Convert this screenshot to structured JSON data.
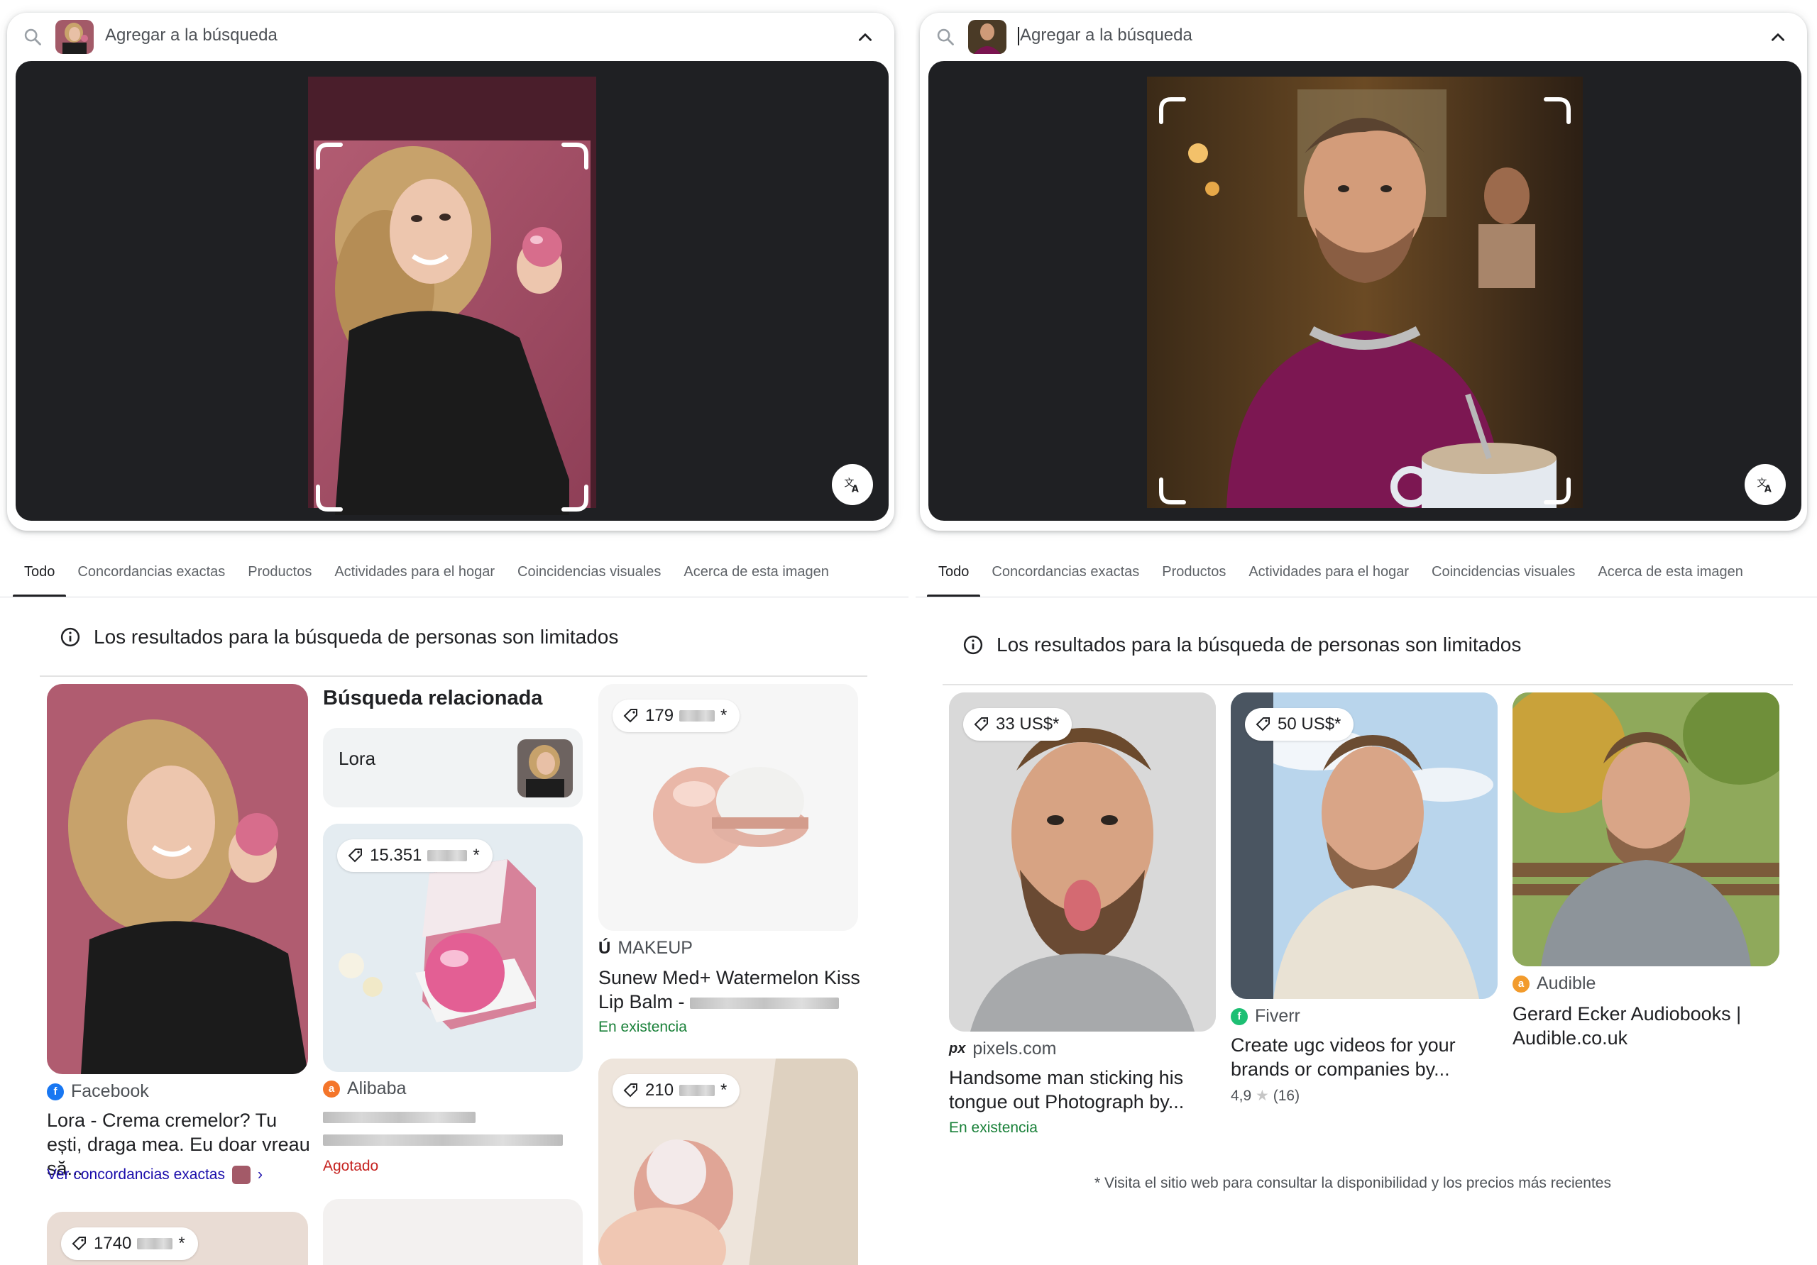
{
  "left": {
    "search": {
      "placeholder": "Agregar a la búsqueda"
    },
    "tabs": [
      "Todo",
      "Concordancias exactas",
      "Productos",
      "Actividades para el hogar",
      "Coincidencias visuales",
      "Acerca de esta imagen"
    ],
    "notice": "Los resultados para la búsqueda de personas son limitados",
    "related": {
      "heading": "Búsqueda relacionada",
      "chip": "Lora"
    },
    "results": [
      {
        "source": "Facebook",
        "title": "Lora - Crema cremelor? Tu ești, draga mea. Eu doar vreau să...",
        "link": "Ver concordancias exactas"
      },
      {
        "price": "15.351",
        "source": "Alibaba",
        "status": "Agotado"
      },
      {
        "price": "179",
        "source": "MAKEUP",
        "title": "Sunew Med+ Watermelon Kiss Lip Balm -",
        "status": "En existencia"
      },
      {
        "price": "210"
      },
      {
        "price": "1740"
      }
    ]
  },
  "right": {
    "search": {
      "placeholder": "Agregar a la búsqueda"
    },
    "tabs": [
      "Todo",
      "Concordancias exactas",
      "Productos",
      "Actividades para el hogar",
      "Coincidencias visuales",
      "Acerca de esta imagen"
    ],
    "notice": "Los resultados para la búsqueda de personas son limitados",
    "results": [
      {
        "price": "33 US$*",
        "source": "pixels.com",
        "title": "Handsome man sticking his tongue out Photograph by...",
        "status": "En existencia"
      },
      {
        "price": "50 US$*",
        "source": "Fiverr",
        "title": "Create ugc videos for your brands or companies by...",
        "rating": "4,9",
        "reviews": "(16)"
      },
      {
        "source": "Audible",
        "title": "Gerard Ecker Audiobooks | Audible.co.uk"
      }
    ],
    "footnote": "* Visita el sitio web para consultar la disponibilidad y los precios más recientes"
  },
  "icons": {
    "search": "search-icon",
    "collapse": "chevron-up-icon",
    "translate": "translate-icon",
    "info": "info-icon",
    "price": "tag-icon",
    "star": "star-icon"
  },
  "colors": {
    "accent": "#1a0dab",
    "stock": "#188038",
    "soldout": "#c5221f",
    "preview_bg": "#1f2023"
  }
}
